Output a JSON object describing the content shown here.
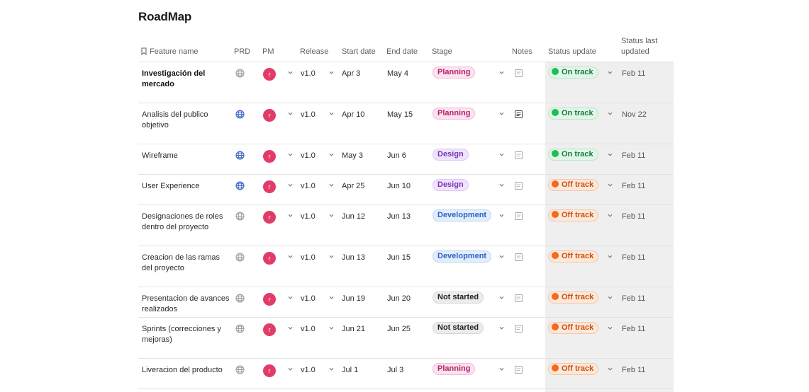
{
  "page": {
    "title": "RoadMap"
  },
  "columns": {
    "feature": "Feature name",
    "prd": "PRD",
    "pm": "PM",
    "release": "Release",
    "start": "Start date",
    "end": "End date",
    "stage": "Stage",
    "notes": "Notes",
    "status": "Status update",
    "updated_line1": "Status last",
    "updated_line2": "updated"
  },
  "colors": {
    "avatar": "#e33b68",
    "on_track": "#1fbd55",
    "off_track": "#f26b1d",
    "planning": "#b2246d",
    "design": "#7a35b8",
    "development": "#2b63c4",
    "prd_linked": "#2f5fbf",
    "prd_empty": "#9a9a9a"
  },
  "rows": [
    {
      "feature": "Investigación del mercado",
      "bold": true,
      "prd": "empty",
      "pm": "r",
      "release": "v1.0",
      "start": "Apr 3",
      "end": "May 4",
      "stage": "Planning",
      "stage_key": "planning",
      "notes": "empty",
      "status": "On track",
      "status_key": "ontrack",
      "updated": "Feb 11"
    },
    {
      "feature": "Analisis del publico objetivo",
      "bold": false,
      "prd": "linked",
      "pm": "r",
      "release": "v1.0",
      "start": "Apr 10",
      "end": "May 15",
      "stage": "Planning",
      "stage_key": "planning",
      "notes": "filled",
      "status": "On track",
      "status_key": "ontrack",
      "updated": "Nov 22"
    },
    {
      "feature": "Wireframe",
      "bold": false,
      "prd": "linked",
      "pm": "r",
      "release": "v1.0",
      "start": "May 3",
      "end": "Jun 6",
      "stage": "Design",
      "stage_key": "design",
      "notes": "empty",
      "status": "On track",
      "status_key": "ontrack",
      "updated": "Feb 11"
    },
    {
      "feature": "User Experience",
      "bold": false,
      "prd": "linked",
      "pm": "r",
      "release": "v1.0",
      "start": "Apr 25",
      "end": "Jun 10",
      "stage": "Design",
      "stage_key": "design",
      "notes": "empty",
      "status": "Off track",
      "status_key": "offtrack",
      "updated": "Feb 11"
    },
    {
      "feature": "Designaciones de roles dentro del proyecto",
      "bold": false,
      "prd": "empty",
      "pm": "r",
      "release": "v1.0",
      "start": "Jun 12",
      "end": "Jun 13",
      "stage": "Development",
      "stage_key": "development",
      "notes": "empty",
      "status": "Off track",
      "status_key": "offtrack",
      "updated": "Feb 11"
    },
    {
      "feature": "Creacion de las ramas del proyecto",
      "bold": false,
      "prd": "empty",
      "pm": "r",
      "release": "v1.0",
      "start": "Jun 13",
      "end": "Jun 15",
      "stage": "Development",
      "stage_key": "development",
      "notes": "empty",
      "status": "Off track",
      "status_key": "offtrack",
      "updated": "Feb 11"
    },
    {
      "feature": "Presentacion de avances realizados",
      "bold": false,
      "prd": "empty",
      "pm": "r",
      "release": "v1.0",
      "start": "Jun 19",
      "end": "Jun 20",
      "stage": "Not started",
      "stage_key": "notstarted",
      "notes": "empty",
      "status": "Off track",
      "status_key": "offtrack",
      "updated": "Feb 11"
    },
    {
      "feature": "Sprints (correcciones y mejoras)",
      "bold": false,
      "prd": "empty",
      "pm": "r",
      "release": "v1.0",
      "start": "Jun 21",
      "end": "Jun 25",
      "stage": "Not started",
      "stage_key": "notstarted",
      "notes": "empty",
      "status": "Off track",
      "status_key": "offtrack",
      "updated": "Feb 11"
    },
    {
      "feature": "Liveracion del producto",
      "bold": false,
      "prd": "empty",
      "pm": "r",
      "release": "v1.0",
      "start": "Jul 1",
      "end": "Jul 3",
      "stage": "Planning",
      "stage_key": "planning",
      "notes": "empty",
      "status": "Off track",
      "status_key": "offtrack",
      "updated": "Feb 11"
    }
  ]
}
